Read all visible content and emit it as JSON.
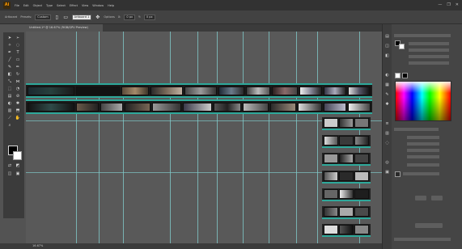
{
  "app": {
    "logo": "Ai",
    "menus": [
      "File",
      "Edit",
      "Object",
      "Type",
      "Select",
      "Effect",
      "View",
      "Window",
      "Help"
    ],
    "window_controls": [
      "—",
      "❐",
      "✕"
    ]
  },
  "controlbar": {
    "items": [
      {
        "label": "Artboard"
      },
      {
        "label": "Presets:",
        "field": "Custom"
      },
      {
        "label": "",
        "field": "Artboard 1",
        "light": true
      },
      {
        "label": "Options"
      },
      {
        "label": "X:",
        "field": "0 px"
      },
      {
        "label": "Y:",
        "field": "0 px"
      }
    ]
  },
  "document": {
    "tab_title": "Untitled-1* @ 16.67% (RGB/GPU Preview)"
  },
  "tools": [
    "selection",
    "direct-selection",
    "magic-wand",
    "lasso",
    "pen",
    "type",
    "line",
    "rectangle",
    "paintbrush",
    "pencil",
    "eraser",
    "rotate",
    "scale",
    "width",
    "free-transform",
    "shape-builder",
    "gradient",
    "eyedropper",
    "blend",
    "symbol-sprayer",
    "graph",
    "artboard",
    "slice",
    "hand",
    "zoom"
  ],
  "colors": {
    "guide": "#7fc8c8",
    "accent_teal": "#2ea89a",
    "canvas_bg": "#595959",
    "panel_bg": "#454545"
  },
  "statusbar": {
    "zoom": "16.67%"
  }
}
